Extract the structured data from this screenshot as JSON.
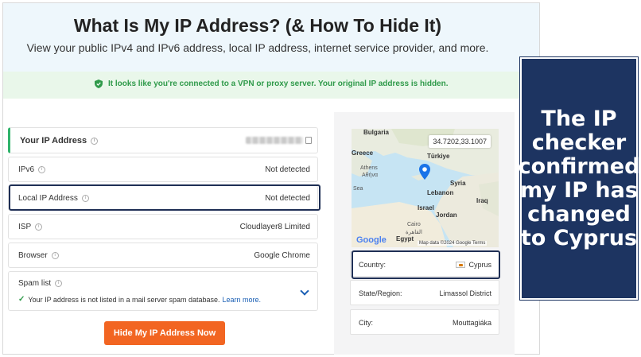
{
  "header": {
    "title": "What Is My IP Address? (& How To Hide It)",
    "subtitle": "View your public IPv4 and IPv6 address, local IP address, internet service provider, and more."
  },
  "vpn_notice": "It looks like you're connected to a VPN or proxy server. Your original IP address is hidden.",
  "rows": {
    "ip": {
      "label": "Your IP Address"
    },
    "ipv6": {
      "label": "IPv6",
      "value": "Not detected"
    },
    "local": {
      "label": "Local IP Address",
      "value": "Not detected"
    },
    "isp": {
      "label": "ISP",
      "value": "Cloudlayer8 Limited"
    },
    "browser": {
      "label": "Browser",
      "value": "Google Chrome"
    },
    "spam": {
      "label": "Spam list",
      "status": "Your IP address is not listed in a mail server spam database.",
      "link": "Learn more."
    }
  },
  "cta": "Hide My IP Address Now",
  "map": {
    "coords": "34.7202,33.1007",
    "labels": {
      "bulgaria": "Bulgaria",
      "turkiye": "Türkiye",
      "athens": "Athens",
      "athens_gr": "Αθήνα",
      "greece": "Greece",
      "sea": "Sea",
      "syria": "Syria",
      "lebanon": "Lebanon",
      "iraq": "Iraq",
      "israel": "Israel",
      "jordan": "Jordan",
      "cairo": "Cairo",
      "cairo_ar": "القاهرة",
      "egypt": "Egypt"
    },
    "google": "Google",
    "credit": "Map data ©2024 Google   Terms"
  },
  "location": {
    "country_label": "Country:",
    "country_value": "Cyprus",
    "region_label": "State/Region:",
    "region_value": "Limassol District",
    "city_label": "City:",
    "city_value": "Mouttagiáka"
  },
  "callout": "The IP checker confirmed my IP has changed to Cyprus",
  "colors": {
    "cta": "#f26522",
    "vpn_text": "#2f9a4a",
    "callout_bg": "#1d3461",
    "highlight": "#1f2f55"
  }
}
